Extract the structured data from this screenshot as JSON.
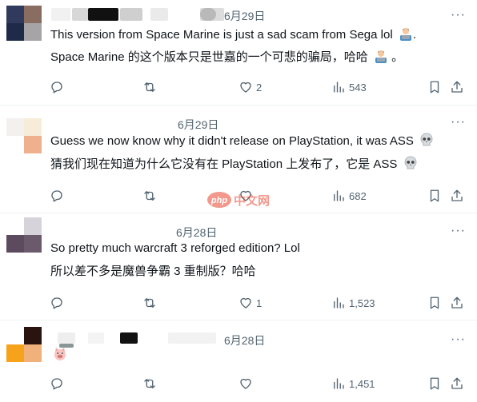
{
  "posts": [
    {
      "date": "6月29日",
      "text_en": "This version from Space Marine is just a sad scam from Sega lol",
      "text_en_tail": ".",
      "text_zh": "Space Marine 的这个版本只是世嘉的一个可悲的骗局，哈哈",
      "text_zh_tail": "。",
      "emoji": "man-technologist-emoji",
      "replies": "",
      "reposts": "",
      "likes": "2",
      "views": "543"
    },
    {
      "date": "6月29日",
      "text_en": "Guess we now know why it didn't release on PlayStation, it was ASS",
      "text_zh": "猜我们现在知道为什么它没有在 PlayStation 上发布了，它是 ASS",
      "emoji": "skull-emoji",
      "replies": "",
      "reposts": "",
      "likes": "",
      "views": "682"
    },
    {
      "date": "6月28日",
      "text_en": "So pretty much warcraft 3 reforged edition? Lol",
      "text_zh": "所以差不多是魔兽争霸 3 重制版？哈哈",
      "replies": "",
      "reposts": "",
      "likes": "1",
      "views": "1,523"
    },
    {
      "date": "6月28日",
      "emoji": "pig-face-emoji",
      "replies": "",
      "reposts": "",
      "likes": "",
      "views": "1,451"
    }
  ],
  "more_label": "···",
  "colors": {
    "text": "#0f1419",
    "secondary": "#536471",
    "divider": "#eff3f4",
    "watermark": "#e8452f"
  }
}
